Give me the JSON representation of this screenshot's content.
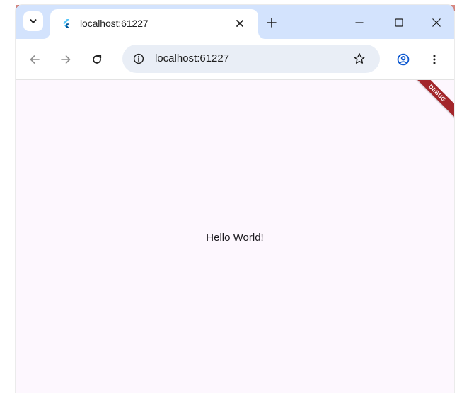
{
  "browser": {
    "tab": {
      "title": "localhost:61227",
      "favicon": "flutter-icon"
    },
    "window_controls": [
      "minimize-icon",
      "maximize-icon",
      "close-icon"
    ],
    "address_bar": {
      "url": "localhost:61227",
      "site_info_icon": "info-icon",
      "bookmark_icon": "star-icon"
    },
    "toolbar_icons": [
      "back-arrow-icon",
      "forward-arrow-icon",
      "reload-icon",
      "profile-icon",
      "kebab-menu-icon"
    ],
    "colors": {
      "tabstrip": "#d3e3fd",
      "omnibox": "#e9eef6",
      "accent": "#0b57d0"
    }
  },
  "page": {
    "message": "Hello World!",
    "debug_banner": "DEBUG",
    "background": "#fdf7fe",
    "banner_color": "#a3262b"
  }
}
